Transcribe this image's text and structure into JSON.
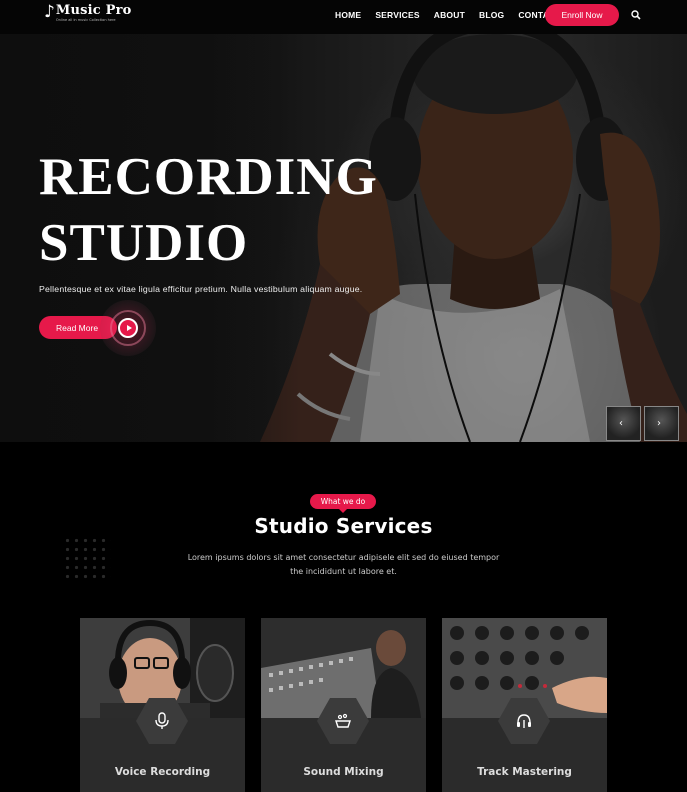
{
  "brand": {
    "name": "Music Pro",
    "tagline": "Online all in music Collection here"
  },
  "nav": {
    "items": [
      "HOME",
      "SERVICES",
      "ABOUT",
      "BLOG",
      "CONTACT"
    ],
    "enroll_label": "Enroll Now"
  },
  "hero": {
    "title_line1": "RECORDING",
    "title_line2": "STUDIO",
    "subtitle": "Pellentesque et ex vitae ligula efficitur pretium. Nulla vestibulum aliquam augue.",
    "read_more_label": "Read More"
  },
  "services": {
    "badge": "What we do",
    "title": "Studio Services",
    "description": "Lorem ipsums dolors sit amet consectetur adipisele elit sed do eiused tempor the incididunt ut labore et.",
    "cards": [
      {
        "title": "Voice Recording",
        "icon": "microphone-icon"
      },
      {
        "title": "Sound Mixing",
        "icon": "mixer-icon"
      },
      {
        "title": "Track Mastering",
        "icon": "headphone-mic-icon"
      }
    ]
  },
  "colors": {
    "accent": "#e6194a",
    "background": "#000000",
    "card": "#2b2b2b"
  }
}
